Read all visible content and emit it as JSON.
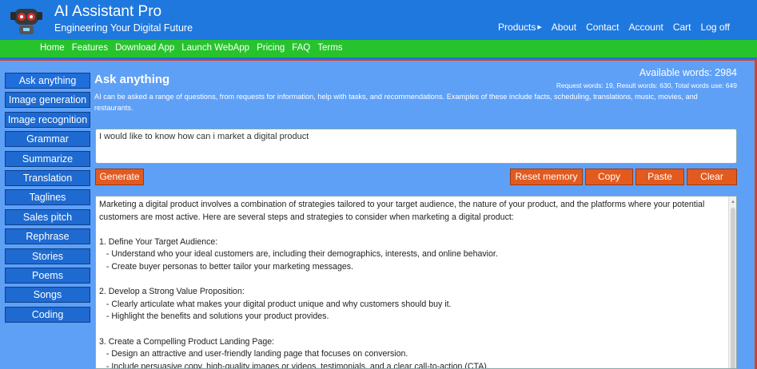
{
  "header": {
    "title": "AI Assistant Pro",
    "subtitle": "Engineering Your Digital Future",
    "nav": [
      {
        "label": "Products",
        "has_caret": true
      },
      {
        "label": "About"
      },
      {
        "label": "Contact"
      },
      {
        "label": "Account"
      },
      {
        "label": "Cart"
      },
      {
        "label": "Log off"
      }
    ]
  },
  "menubar": {
    "items": [
      "Home",
      "Features",
      "Download App",
      "Launch WebApp",
      "Pricing",
      "FAQ",
      "Terms"
    ]
  },
  "sidebar": {
    "items": [
      "Ask anything",
      "Image generation",
      "Image recognition",
      "Grammar",
      "Summarize",
      "Translation",
      "Taglines",
      "Sales pitch",
      "Rephrase",
      "Stories",
      "Poems",
      "Songs",
      "Coding"
    ]
  },
  "main": {
    "title": "Ask anything",
    "available_words": "Available words: 2984",
    "word_stats": "Request words: 19, Result words: 630, Total words use: 649",
    "description": "AI can be asked a range of questions, from requests for information, help with tasks, and recommendations. Examples of these include facts, scheduling, translations, music, movies, and restaurants.",
    "prompt_value": "I would like to know how can i market a digital product",
    "buttons": {
      "generate": "Generate",
      "reset": "Reset memory",
      "copy": "Copy",
      "paste": "Paste",
      "clear": "Clear"
    },
    "output": "Marketing a digital product involves a combination of strategies tailored to your target audience, the nature of your product, and the platforms where your potential customers are most active. Here are several steps and strategies to consider when marketing a digital product:\n\n1. Define Your Target Audience:\n   - Understand who your ideal customers are, including their demographics, interests, and online behavior.\n   - Create buyer personas to better tailor your marketing messages.\n\n2. Develop a Strong Value Proposition:\n   - Clearly articulate what makes your digital product unique and why customers should buy it.\n   - Highlight the benefits and solutions your product provides.\n\n3. Create a Compelling Product Landing Page:\n   - Design an attractive and user-friendly landing page that focuses on conversion.\n   - Include persuasive copy, high-quality images or videos, testimonials, and a clear call-to-action (CTA)."
  },
  "colors": {
    "header_bg": "#1f78de",
    "menubar_bg": "#27c32d",
    "content_bg": "#5fa0f7",
    "accent_button": "#e35a1f",
    "sidebar_button": "#1e6ad0"
  }
}
